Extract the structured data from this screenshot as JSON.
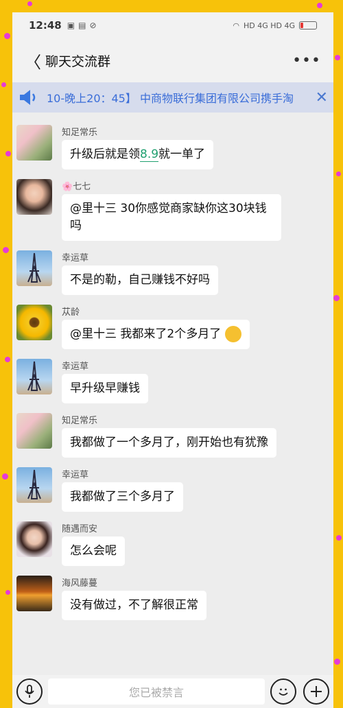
{
  "status": {
    "time": "12:48",
    "left_icons": [
      "sim-icon",
      "photo-icon",
      "mute-icon"
    ],
    "right_text": "HD 4G HD 4G"
  },
  "header": {
    "title": "聊天交流群"
  },
  "notice": {
    "text": "10-晚上20：45】 中商物联行集团有限公司携手淘"
  },
  "messages": [
    {
      "sender": "知足常乐",
      "text": "升级后就是领8.9就一单了",
      "avatar": "flowers"
    },
    {
      "sender": "🌸七七",
      "text": "@里十三 30你感觉商家缺你这30块钱吗",
      "avatar": "girl"
    },
    {
      "sender": "幸运草",
      "text": "不是的勒，自己赚钱不好吗",
      "avatar": "eiffel"
    },
    {
      "sender": "苁龄",
      "text": "@里十三 我都来了2个多月了",
      "avatar": "sunflower"
    },
    {
      "sender": "幸运草",
      "text": "早升级早赚钱",
      "avatar": "eiffel"
    },
    {
      "sender": "知足常乐",
      "text": "我都做了一个多月了，刚开始也有犹豫",
      "avatar": "flowers"
    },
    {
      "sender": "幸运草",
      "text": "我都做了三个多月了",
      "avatar": "eiffel"
    },
    {
      "sender": "随遇而安",
      "text": "怎么会呢",
      "avatar": "woman"
    },
    {
      "sender": "海风藤蔓",
      "text": "没有做过，不了解很正常",
      "avatar": "sunset"
    }
  ],
  "input": {
    "placeholder": "您已被禁言"
  }
}
